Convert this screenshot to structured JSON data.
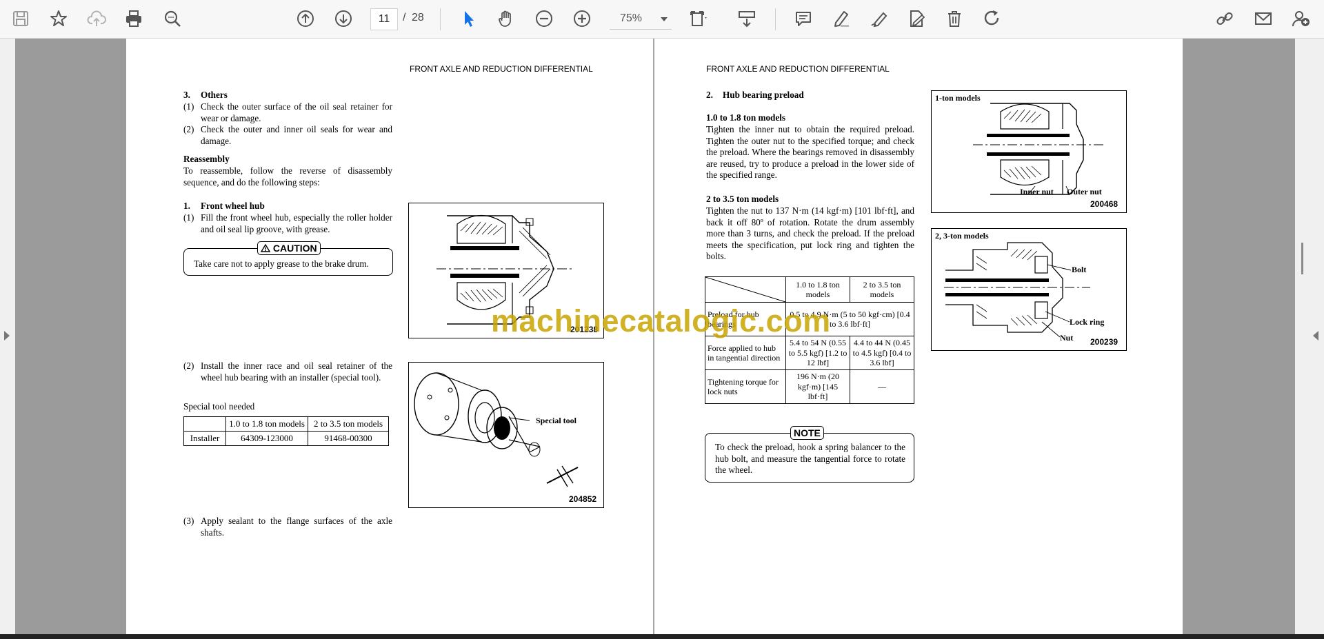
{
  "toolbar": {
    "page_current": "11",
    "page_sep": "/",
    "page_total": "28",
    "zoom": "75%"
  },
  "left_page": {
    "header": "FRONT AXLE AND REDUCTION DIFFERENTIAL",
    "others_num": "3.",
    "others_title": "Others",
    "others_items": [
      {
        "num": "(1)",
        "text": "Check the outer surface of the oil seal retainer for wear or damage."
      },
      {
        "num": "(2)",
        "text": "Check the outer and inner oil seals for wear and damage."
      }
    ],
    "reassembly_title": "Reassembly",
    "reassembly_text": "To reassemble, follow the reverse of disassembly sequence, and do the following steps:",
    "fwh_num": "1.",
    "fwh_title": "Front wheel hub",
    "fwh_item1_num": "(1)",
    "fwh_item1": "Fill the front wheel hub, especially the roller holder and oil seal lip groove, with grease.",
    "caution_tag": "CAUTION",
    "caution_text": "Take care not to apply grease to the brake drum.",
    "fig1_no": "201238",
    "fwh_item2_num": "(2)",
    "fwh_item2": "Install the inner race and oil seal retainer of the wheel hub bearing with an installer (special tool).",
    "special_tool_label": "Special tool needed",
    "tool_table": {
      "headers": [
        "",
        "1.0 to 1.8 ton models",
        "2 to 3.5 ton models"
      ],
      "row": [
        "Installer",
        "64309-123000",
        "91468-00300"
      ]
    },
    "fig2_label": "Special tool",
    "fig2_no": "204852",
    "fwh_item3_num": "(3)",
    "fwh_item3": "Apply sealant to the flange surfaces of the axle shafts."
  },
  "right_page": {
    "header": "FRONT AXLE AND REDUCTION DIFFERENTIAL",
    "hub_num": "2.",
    "hub_title": "Hub bearing preload",
    "sub1_title": "1.0 to 1.8 ton models",
    "sub1_text": "Tighten the inner nut to obtain the required preload. Tighten the outer nut to the specified torque; and check the preload. Where the bearings removed in disassembly are reused, try to produce a preload in the lower side of the specified range.",
    "sub2_title": "2 to 3.5 ton models",
    "sub2_text": "Tighten the nut to 137 N·m (14 kgf·m) [101 lbf·ft], and back it off 80º of rotation. Rotate the drum assembly more than 3 turns, and check the preload. If the preload meets the specification, put lock ring and tighten the bolts.",
    "preload_table": {
      "col1": "1.0 to 1.8 ton models",
      "col2": "2 to 3.5 ton models",
      "rows": [
        {
          "label": "Preload for hub bearings",
          "merged": "0.5 to 4.9 N·m (5 to 50 kgf·cm) [0.4 to 3.6 lbf·ft]"
        },
        {
          "label": "Force applied to hub in tangential direction",
          "c1": "5.4 to 54 N (0.55 to 5.5 kgf) [1.2 to 12 lbf]",
          "c2": "4.4 to 44 N (0.45 to 4.5 kgf) [0.4 to 3.6 lbf]"
        },
        {
          "label": "Tightening torque for lock nuts",
          "c1": "196 N·m (20 kgf·m) [145 lbf·ft]",
          "c2": "—"
        }
      ]
    },
    "note_tag": "NOTE",
    "note_text": "To check the preload, hook a spring balancer to the hub bolt, and measure the tangential force to rotate the wheel.",
    "fig3_title": "1-ton models",
    "fig3_inner": "Inner nut",
    "fig3_outer": "Outer nut",
    "fig3_no": "200468",
    "fig4_title": "2, 3-ton models",
    "fig4_bolt": "Bolt",
    "fig4_lockring": "Lock ring",
    "fig4_nut": "Nut",
    "fig4_no": "200239"
  },
  "watermark": "machinecatalogic.com"
}
